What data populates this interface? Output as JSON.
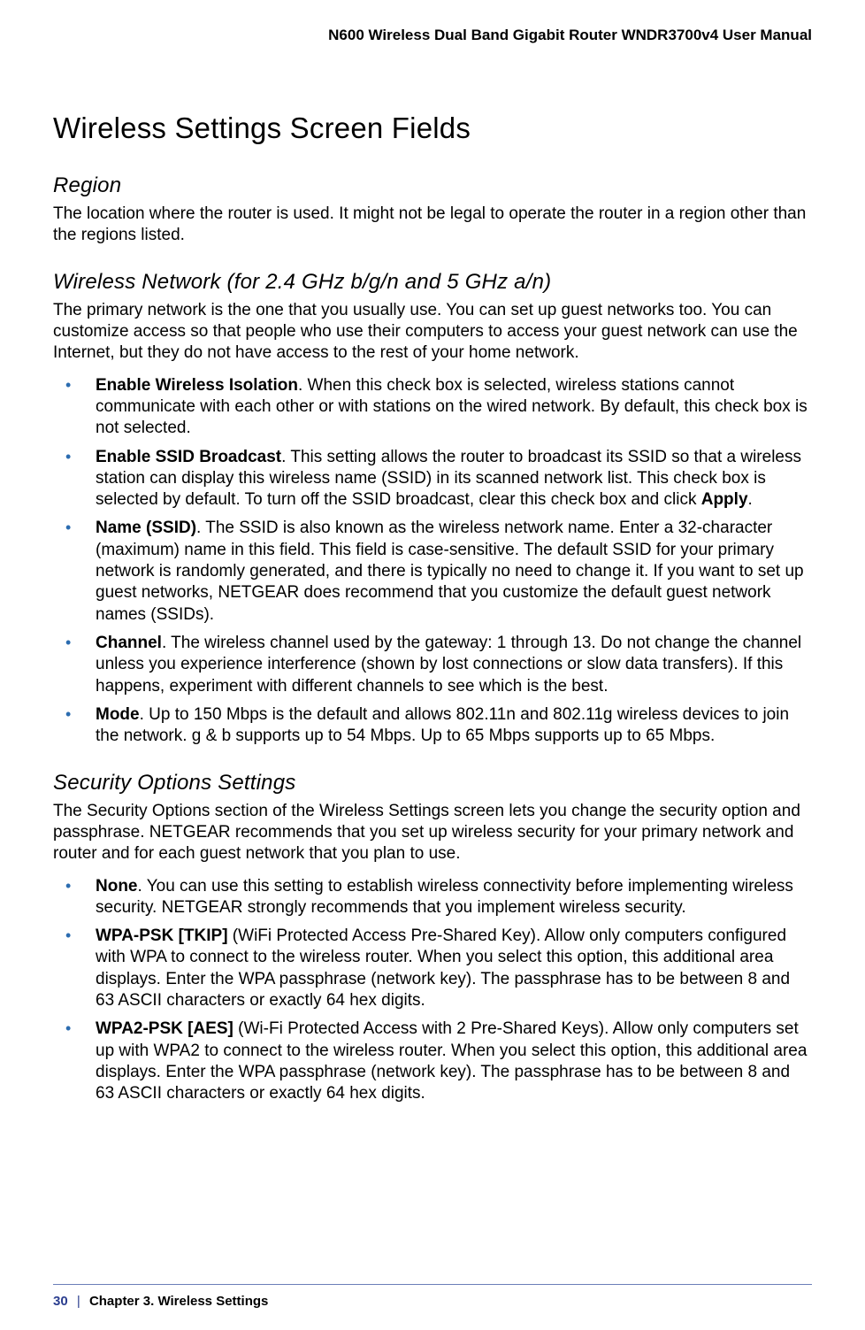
{
  "header": {
    "manual_title": "N600 Wireless Dual Band Gigabit Router WNDR3700v4 User Manual"
  },
  "title": "Wireless Settings Screen Fields",
  "region": {
    "heading": "Region",
    "body": "The location where the router is used. It might not be legal to operate the router in a region other than the regions listed."
  },
  "wireless_network": {
    "heading": "Wireless Network (for 2.4 GHz b/g/n and 5 GHz a/n)",
    "intro": "The primary network is the one that you usually use. You can set up guest networks too. You can customize access so that people who use their computers to access your guest network can use the Internet, but they do not have access to the rest of your home network.",
    "items": [
      {
        "term": "Enable Wireless Isolation",
        "desc": ". When this check box is selected, wireless stations cannot communicate with each other or with stations on the wired network. By default, this check box is not selected."
      },
      {
        "term": "Enable SSID Broadcast",
        "desc_pre": ". This setting allows the router to broadcast its SSID so that a wireless station can display this wireless name (SSID) in its scanned network list. This check box is selected by default. To turn off the SSID broadcast, clear this check box and click ",
        "apply_word": "Apply",
        "desc_post": "."
      },
      {
        "term": "Name (SSID)",
        "desc": ". The SSID is also known as the wireless network name. Enter a 32-character (maximum) name in this field. This field is case-sensitive. The default SSID for your primary network is randomly generated, and there is typically no need to change it. If you want to set up guest networks, NETGEAR does recommend that you customize the default guest network names (SSIDs)."
      },
      {
        "term": "Channel",
        "desc": ". The wireless channel used by the gateway: 1 through 13. Do not change the channel unless you experience interference (shown by lost connections or slow data transfers). If this happens, experiment with different channels to see which is the best."
      },
      {
        "term": "Mode",
        "desc": ". Up to 150 Mbps is the default and allows 802.11n and 802.11g wireless devices to join the network. g & b supports up to 54 Mbps. Up to 65 Mbps supports up to 65 Mbps."
      }
    ]
  },
  "security": {
    "heading": "Security Options Settings",
    "intro": "The Security Options section of the Wireless Settings screen lets you change the security option and passphrase. NETGEAR recommends that you set up wireless security for your primary network and router and for each guest network that you plan to use.",
    "items": [
      {
        "term": "None",
        "desc": ". You can use this setting to establish wireless connectivity before implementing wireless security. NETGEAR strongly recommends that you implement wireless security."
      },
      {
        "term": "WPA-PSK [TKIP]",
        "desc": " (WiFi Protected Access Pre-Shared Key). Allow only computers configured with WPA to connect to the wireless router. When you select this option, this additional area displays. Enter the WPA passphrase (network key). The passphrase has to be between 8 and 63 ASCII characters or exactly 64 hex digits."
      },
      {
        "term": "WPA2-PSK [AES]",
        "desc": " (Wi-Fi Protected Access with 2 Pre-Shared Keys). Allow only computers set up with WPA2 to connect to the wireless router. When you select this option, this additional area displays. Enter the WPA passphrase (network key). The passphrase has to be between 8 and 63 ASCII characters or exactly 64 hex digits."
      }
    ]
  },
  "footer": {
    "page_number": "30",
    "chapter": "Chapter 3.  Wireless Settings"
  }
}
